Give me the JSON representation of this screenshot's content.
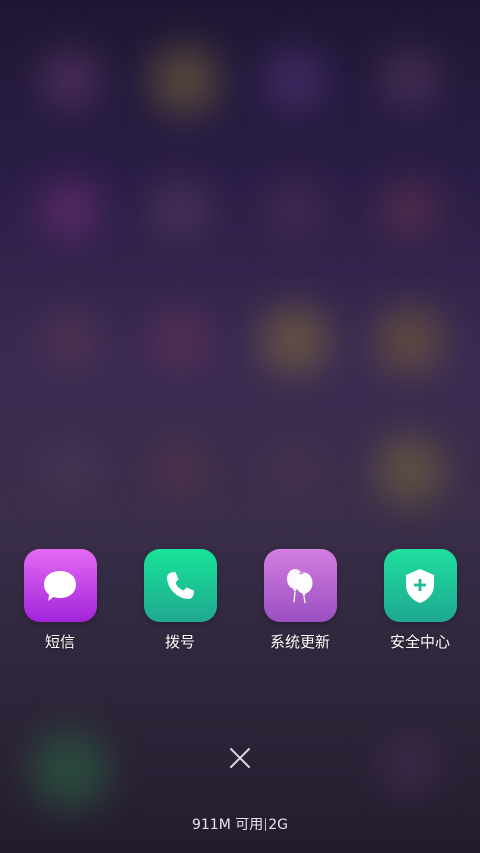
{
  "dock": {
    "apps": [
      {
        "label": "短信",
        "icon": "chat-bubble-icon",
        "color_top": "#e46af3",
        "color_bottom": "#9b1fd8"
      },
      {
        "label": "拨号",
        "icon": "phone-icon",
        "color_top": "#17e49a",
        "color_bottom": "#21a88f"
      },
      {
        "label": "系统更新",
        "icon": "balloons-icon",
        "color_top": "#d37ee0",
        "color_bottom": "#9b4fc1"
      },
      {
        "label": "安全中心",
        "icon": "shield-plus-icon",
        "color_top": "#1fe09f",
        "color_bottom": "#1ea791"
      }
    ]
  },
  "close": {
    "icon": "close-icon"
  },
  "status": {
    "memory": "911M 可用",
    "network": "2G"
  }
}
